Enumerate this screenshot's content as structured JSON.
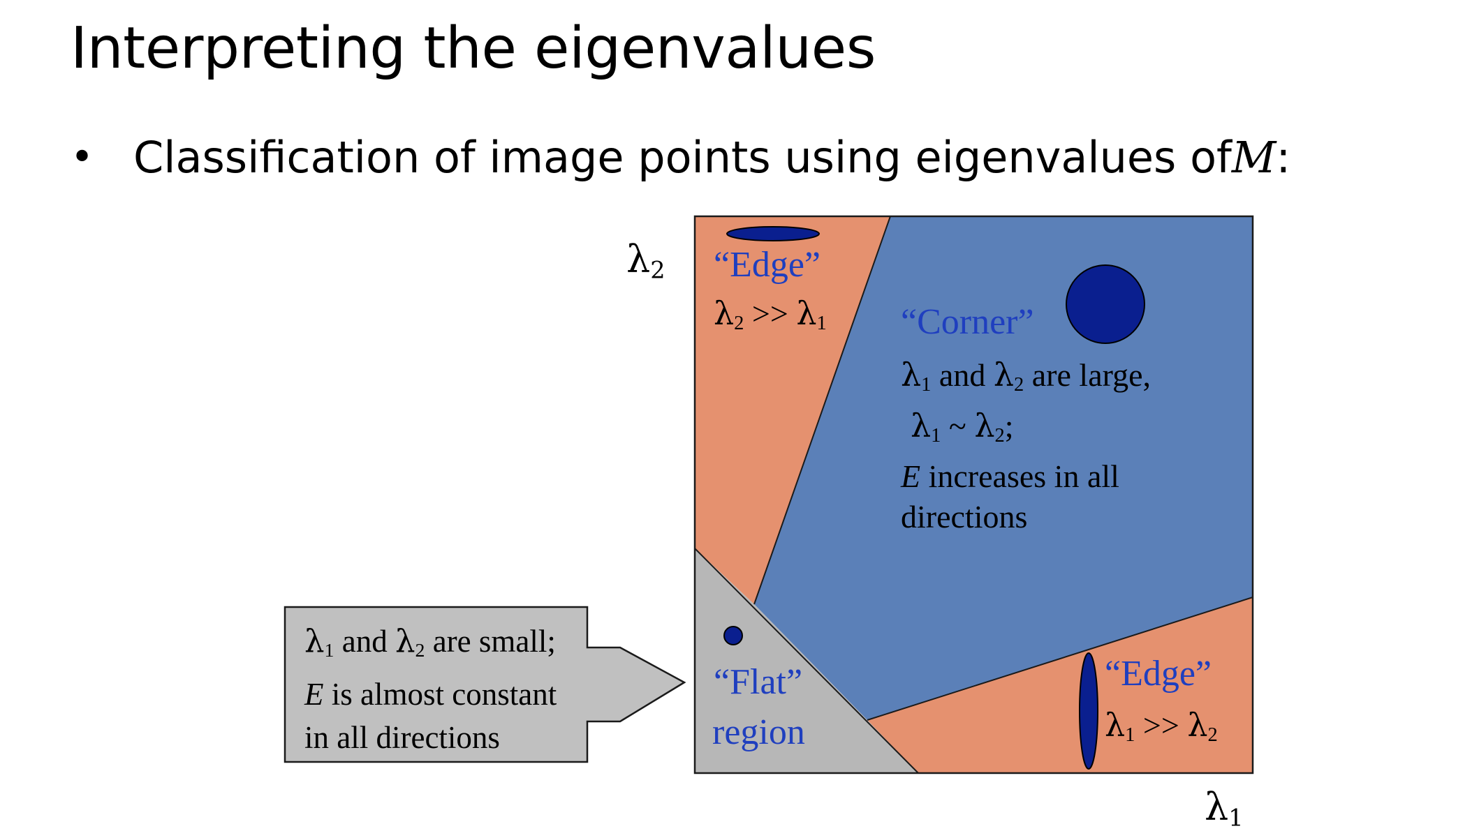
{
  "slide": {
    "title": "Interpreting the eigenvalues",
    "bullet": {
      "marker": "•",
      "text": "Classification of image points using eigenvalues of ",
      "math": "M",
      "suffix": ":"
    }
  },
  "diagram": {
    "axes": {
      "y_symbol": "λ",
      "y_sub": "2",
      "x_symbol": "λ",
      "x_sub": "1"
    },
    "regions": {
      "edge_top": {
        "label": "“Edge”",
        "cond_sym1": "λ",
        "cond_sub1": "2",
        "cond_op": " >> ",
        "cond_sym2": "λ",
        "cond_sub2": "1"
      },
      "corner": {
        "label": "“Corner”",
        "l1_sym": "λ",
        "l1_sub": "1",
        "l1_mid": " and ",
        "l1_sym2": "λ",
        "l1_sub2": "2",
        "l1_end": " are large,",
        "l2_sym": "λ",
        "l2_sub": "1",
        "l2_op": " ~ ",
        "l2_sym2": "λ",
        "l2_sub2": "2",
        "l2_end": ";",
        "l3_var": "E",
        "l3_rest": " increases in all",
        "l4": "directions"
      },
      "edge_bottom": {
        "label": "“Edge”",
        "cond_sym1": "λ",
        "cond_sub1": "1",
        "cond_op": " >> ",
        "cond_sym2": "λ",
        "cond_sub2": "2"
      },
      "flat": {
        "label_line1": "“Flat”",
        "label_line2": "region"
      }
    },
    "callout": {
      "l1_sym": "λ",
      "l1_sub": "1",
      "l1_mid": " and ",
      "l1_sym2": "λ",
      "l1_sub2": "2",
      "l1_end": " are small;",
      "l2_var": "E",
      "l2_rest": " is almost constant",
      "l3": "in all directions"
    },
    "colors": {
      "edge_region": "#e5916f",
      "corner_region": "#5b80b8",
      "flat_region": "#b7b7b7",
      "callout_fill": "#c0c0c0",
      "shape_fill": "#0a1f8f",
      "label_blue": "#1f3fbf"
    }
  }
}
